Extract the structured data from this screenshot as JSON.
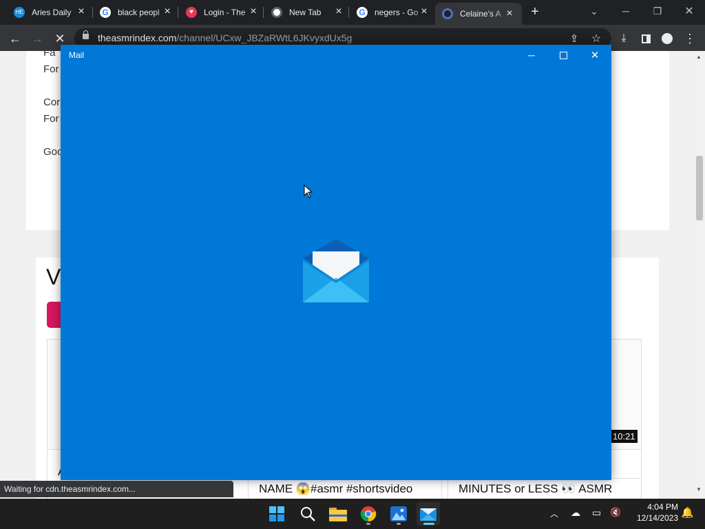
{
  "browser": {
    "tabs": [
      {
        "label": "Aries Daily",
        "color": "#1c8adb"
      },
      {
        "label": "black peopl",
        "color": "#4285f4"
      },
      {
        "label": "Login - The",
        "color": "#e53950"
      },
      {
        "label": "New Tab",
        "color": "#9aa0a6"
      },
      {
        "label": "negers - Go",
        "color": "#4285f4"
      },
      {
        "label": "Celaine's A",
        "color": "#4f6fc9"
      }
    ],
    "active_tab_index": 5,
    "new_tab_symbol": "+",
    "address": {
      "host": "theasmrindex.com",
      "path": "/channel/UCxw_JBZaRWtL6JKvyxdUx5g"
    },
    "status_text": "Waiting for cdn.theasmrindex.com..."
  },
  "page": {
    "text_fragments": [
      "Fa",
      "For",
      "Cor",
      "For",
      "Goo",
      "V"
    ],
    "video_duration": "10:21",
    "card_titles": [
      "NAME 😱#asmr #shortsvideo",
      "MINUTES or LESS 👀 ASMR"
    ],
    "card_left_letter": "A"
  },
  "mail_window": {
    "title": "Mail",
    "bg_color": "#0078d7",
    "icon": "mail-envelope-icon"
  },
  "taskbar": {
    "apps": [
      "start-icon",
      "search-icon",
      "file-explorer-icon",
      "chrome-icon",
      "photos-icon",
      "mail-icon"
    ],
    "clock_time": "4:04 PM",
    "clock_date": "12/14/2023"
  }
}
